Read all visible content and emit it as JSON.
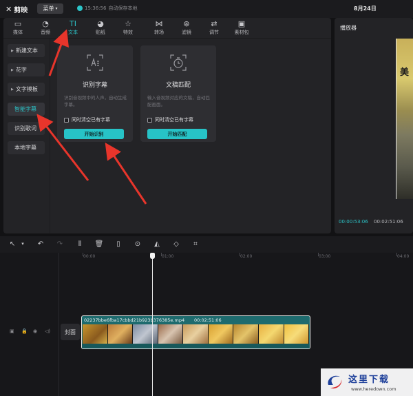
{
  "app": {
    "logo_text": "剪映",
    "menu_label": "菜单",
    "save_time": "15:36:56",
    "save_text": "自动保存本地",
    "date": "8月24日"
  },
  "toolbar": {
    "items": [
      {
        "label": "媒体",
        "icon": "media-icon"
      },
      {
        "label": "音频",
        "icon": "audio-icon"
      },
      {
        "label": "文本",
        "icon": "text-icon",
        "active": true
      },
      {
        "label": "贴纸",
        "icon": "sticker-icon"
      },
      {
        "label": "特效",
        "icon": "effects-icon"
      },
      {
        "label": "转场",
        "icon": "transition-icon"
      },
      {
        "label": "滤镜",
        "icon": "filter-icon"
      },
      {
        "label": "调节",
        "icon": "adjust-icon"
      },
      {
        "label": "素材包",
        "icon": "package-icon"
      }
    ]
  },
  "sidebar": {
    "items": [
      {
        "label": "新建文本"
      },
      {
        "label": "花字"
      },
      {
        "label": "文字模板"
      },
      {
        "label": "智能字幕",
        "active": true
      },
      {
        "label": "识别歌词"
      },
      {
        "label": "本地字幕"
      }
    ]
  },
  "cards": [
    {
      "title": "识别字幕",
      "desc": "识别音视频中的人声，自动生成字幕。",
      "check_label": "同时清空已有字幕",
      "button": "开始识别"
    },
    {
      "title": "文稿匹配",
      "desc": "输入音视频对应的文稿，自动匹配画面。",
      "check_label": "同时清空已有字幕",
      "button": "开始匹配"
    }
  ],
  "player": {
    "title": "播放器",
    "current_time": "00:00:53:06",
    "total_time": "00:02:51:06"
  },
  "timeline": {
    "ruler": [
      "00:00",
      "01:00",
      "02:00",
      "03:00",
      "04:00"
    ],
    "cover_label": "封面",
    "clip": {
      "name": "02237bbe6fba17cbbd21b923b376385e.mp4",
      "duration": "00:02:51:06"
    }
  },
  "watermark": {
    "text": "这里下载",
    "url": "www.heredown.com"
  },
  "colors": {
    "accent": "#2cc5c9",
    "arrow": "#e8352b"
  }
}
